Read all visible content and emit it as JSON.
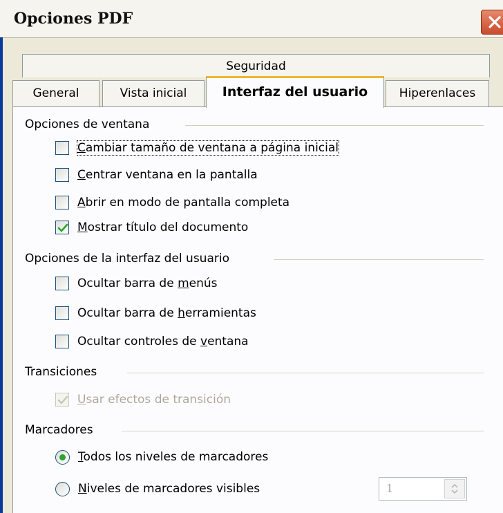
{
  "window": {
    "title": "Opciones PDF"
  },
  "tabs": {
    "row_back": [
      "Seguridad"
    ],
    "row_front": [
      "General",
      "Vista inicial",
      "Interfaz del usuario",
      "Hiperenlaces"
    ],
    "active": "Interfaz del usuario"
  },
  "groups": {
    "window_options": {
      "title": "Opciones de ventana",
      "items": [
        {
          "pre": "",
          "key": "C",
          "post": "ambiar tamaño de ventana a página inicial",
          "checked": false
        },
        {
          "pre": "",
          "key": "C",
          "post": "entrar ventana en la pantalla",
          "checked": false
        },
        {
          "pre": "",
          "key": "A",
          "post": "brir en modo de pantalla completa",
          "checked": false
        },
        {
          "pre": "",
          "key": "M",
          "post": "ostrar título del documento",
          "checked": true
        }
      ]
    },
    "ui_options": {
      "title": "Opciones de la interfaz del usuario",
      "items": [
        {
          "pre": "Ocultar barra de ",
          "key": "m",
          "post": "enús",
          "checked": false
        },
        {
          "pre": "Ocultar barra de ",
          "key": "h",
          "post": "erramientas",
          "checked": false
        },
        {
          "pre": "Ocultar controles de ",
          "key": "v",
          "post": "entana",
          "checked": false
        }
      ]
    },
    "transitions": {
      "title": "Transiciones",
      "items": [
        {
          "pre": "",
          "key": "U",
          "post": "sar efectos de transición",
          "checked": true,
          "disabled": true
        }
      ]
    },
    "bookmarks": {
      "title": "Marcadores",
      "options": [
        {
          "pre": "",
          "key": "T",
          "post": "odos los niveles de marcadores",
          "selected": true
        },
        {
          "pre": "",
          "key": "N",
          "post": "iveles de marcadores visibles",
          "selected": false
        }
      ],
      "levels_value": "1"
    }
  },
  "colors": {
    "accent_tab": "#f0b530",
    "check": "#2ba52e",
    "close": "#c94b2b"
  }
}
